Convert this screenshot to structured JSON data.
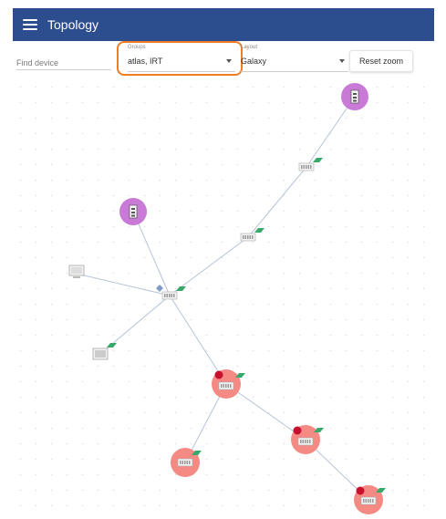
{
  "header": {
    "title": "Topology"
  },
  "toolbar": {
    "find_placeholder": "Find device",
    "groups_label": "Groups",
    "groups_value": "atlas, IRT",
    "layout_label": "Layout",
    "layout_value": "Galaxy",
    "reset_label": "Reset zoom"
  },
  "colors": {
    "appbar": "#2d4e8e",
    "highlight": "#ef7d21",
    "node_purple": "#c979d6",
    "node_red": "#f58a85",
    "alarm": "#c8102e",
    "flag_green": "#38a86b",
    "edge": "#b7c4d6"
  }
}
